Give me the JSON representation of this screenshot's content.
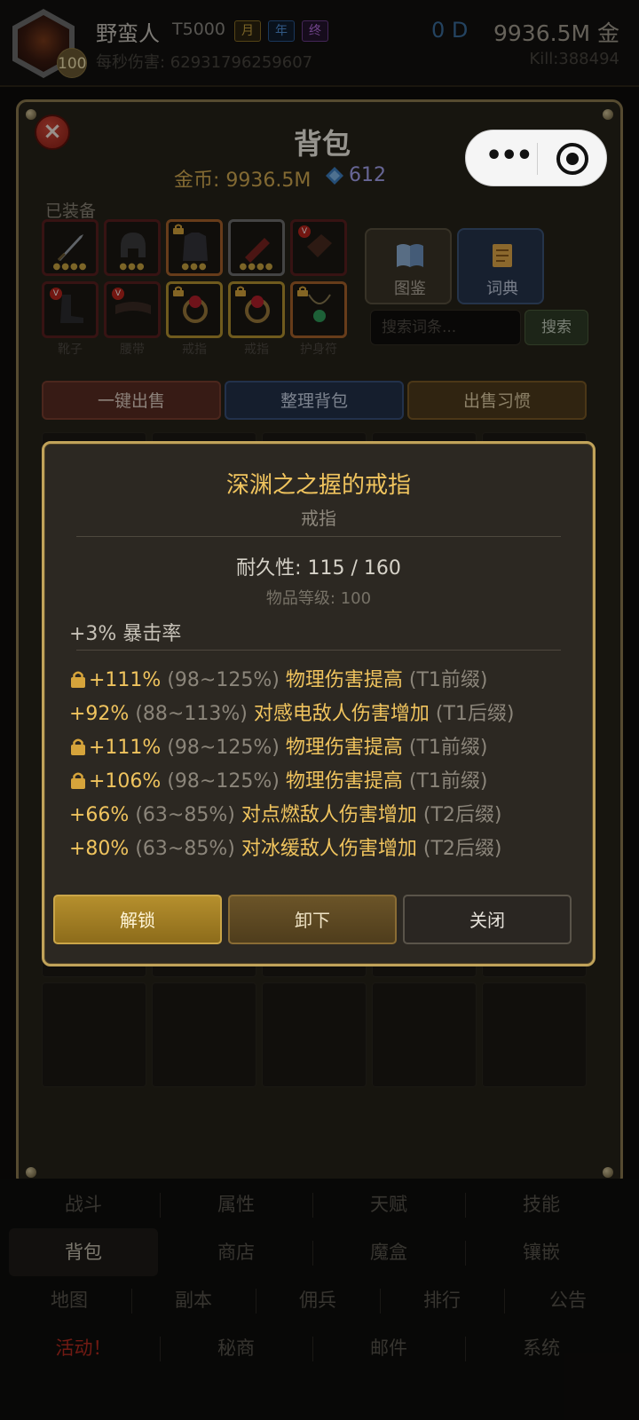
{
  "header": {
    "player_name": "野蛮人",
    "tier": "T5000",
    "tags": [
      "月",
      "年",
      "终"
    ],
    "level": "100",
    "dps_label": "每秒伤害: 62931796259607",
    "od": "0 D",
    "gold": "9936.5M 金",
    "kill": "Kill:388494"
  },
  "panel": {
    "title": "背包",
    "gold_line": "金币: 9936.5M",
    "gem_count": "612",
    "close_glyph": "×",
    "equipped_label": "已装备",
    "slot_labels": [
      "靴子",
      "腰带",
      "戒指",
      "戒指",
      "护身符"
    ],
    "atlas_label": "图鉴",
    "dict_label": "词典",
    "search_placeholder": "搜索词条...",
    "search_button": "搜索",
    "sell_all": "一键出售",
    "sort_bag": "整理背包",
    "sell_habit": "出售习惯"
  },
  "tooltip": {
    "title": "深渊之之握的戒指",
    "type": "戒指",
    "durability": "耐久性: 115 / 160",
    "item_level": "物品等级: 100",
    "base_stat": "+3% 暴击率",
    "affixes": [
      {
        "locked": true,
        "value": "+111%",
        "range": "(98~125%)",
        "text": "物理伤害提高",
        "tier": "(T1前缀)"
      },
      {
        "locked": false,
        "value": "+92%",
        "range": "(88~113%)",
        "text": "对感电敌人伤害增加",
        "tier": "(T1后缀)"
      },
      {
        "locked": true,
        "value": "+111%",
        "range": "(98~125%)",
        "text": "物理伤害提高",
        "tier": "(T1前缀)"
      },
      {
        "locked": true,
        "value": "+106%",
        "range": "(98~125%)",
        "text": "物理伤害提高",
        "tier": "(T1前缀)"
      },
      {
        "locked": false,
        "value": "+66%",
        "range": "(63~85%)",
        "text": "对点燃敌人伤害增加",
        "tier": "(T2后缀)"
      },
      {
        "locked": false,
        "value": "+80%",
        "range": "(63~85%)",
        "text": "对冰缓敌人伤害增加",
        "tier": "(T2后缀)"
      }
    ],
    "unlock_button": "解锁",
    "unequip_button": "卸下",
    "close_button": "关闭"
  },
  "bottom_nav": {
    "row1": [
      "战斗",
      "属性",
      "天赋",
      "技能"
    ],
    "row2": [
      "背包",
      "商店",
      "魔盒",
      "镶嵌"
    ],
    "row3": [
      "地图",
      "副本",
      "佣兵",
      "排行",
      "公告"
    ],
    "row4": [
      "活动！",
      "秘商",
      "邮件",
      "系统"
    ]
  },
  "colors": {
    "accent_gold": "#f0c45e",
    "modal_border": "#c1a35a",
    "panel_border": "#8b7a4e",
    "hot_red": "#b52a1f"
  }
}
